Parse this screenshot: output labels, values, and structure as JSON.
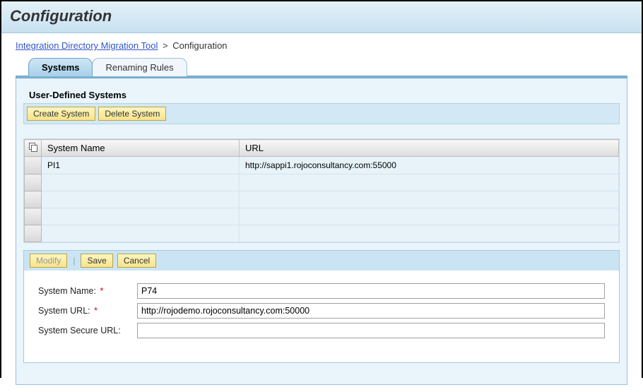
{
  "header": {
    "title": "Configuration"
  },
  "breadcrumb": {
    "root": "Integration Directory Migration Tool",
    "sep": ">",
    "current": "Configuration"
  },
  "tabs": {
    "systems": "Systems",
    "renaming": "Renaming Rules"
  },
  "section": {
    "title": "User-Defined Systems",
    "create_btn": "Create System",
    "delete_btn": "Delete System"
  },
  "table": {
    "col_name": "System Name",
    "col_url": "URL",
    "rows": [
      {
        "name": "PI1",
        "url": "http://sappi1.rojoconsultancy.com:55000"
      }
    ]
  },
  "editor": {
    "modify_btn": "Modify",
    "save_btn": "Save",
    "cancel_btn": "Cancel",
    "labels": {
      "name": "System Name:",
      "url": "System URL:",
      "secure": "System Secure URL:"
    },
    "values": {
      "name": "P74",
      "url": "http://rojodemo.rojoconsultancy.com:50000",
      "secure": ""
    }
  }
}
